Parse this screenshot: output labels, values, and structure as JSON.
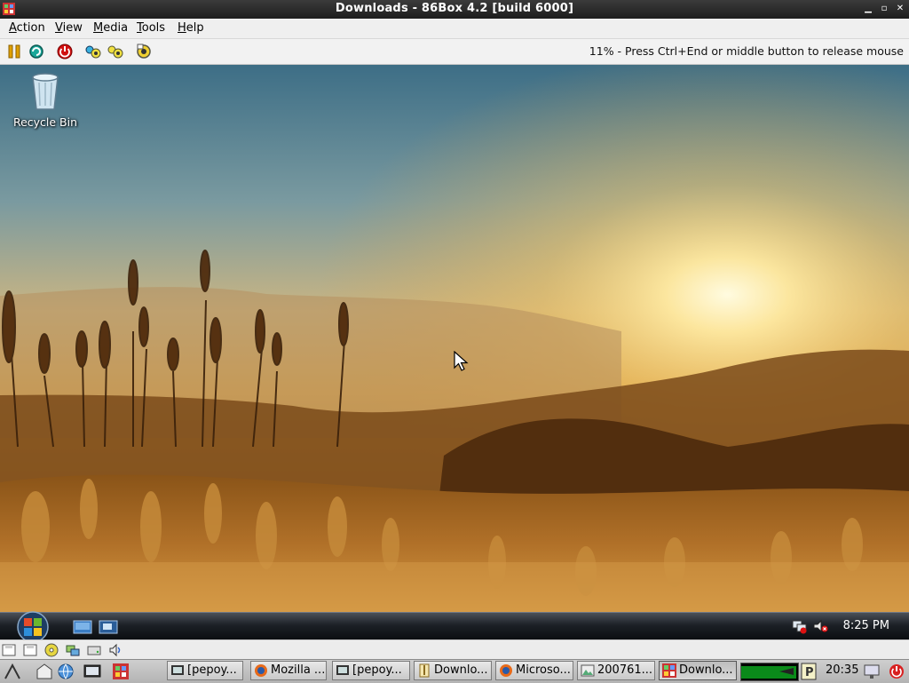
{
  "window": {
    "title": "Downloads - 86Box 4.2 [build 6000]",
    "app_icon": "86box-icon",
    "controls": [
      "minimize-icon",
      "maximize-icon",
      "close-icon"
    ]
  },
  "menubar": {
    "items": [
      "Action",
      "View",
      "Media",
      "Tools",
      "Help"
    ]
  },
  "toolbar": {
    "buttons": [
      "pause-icon",
      "reset-icon",
      "power-icon",
      "ctrl-alt-del-icon",
      "ctrl-alt-esc-icon",
      "settings-icon"
    ],
    "status": "11% - Press Ctrl+End or middle button to release mouse"
  },
  "desktop": {
    "icons": [
      {
        "label": "Recycle Bin",
        "icon": "recycle-bin-icon"
      }
    ]
  },
  "vista_taskbar": {
    "start": "windows-start-orb",
    "quick_launch": [
      "show-desktop-icon",
      "switch-windows-icon"
    ],
    "tray": [
      "network-disconnected-icon",
      "volume-muted-icon"
    ],
    "clock": "8:25 PM"
  },
  "host_status": {
    "icons": [
      "floppy-drive-icon",
      "floppy-drive-icon",
      "cdrom-icon",
      "network-icon",
      "hard-disk-icon",
      "sound-icon"
    ]
  },
  "host_panel": {
    "launchers": [
      "menu-icon",
      "home-folder-icon",
      "browser-icon",
      "terminal-icon",
      "86box-icon"
    ],
    "tasks": [
      {
        "label": "[pepoy...",
        "icon": "terminal-icon"
      },
      {
        "label": "Mozilla ...",
        "icon": "firefox-icon"
      },
      {
        "label": "[pepoy...",
        "icon": "terminal-icon"
      },
      {
        "label": "Downlo...",
        "icon": "archive-icon"
      },
      {
        "label": "Microso...",
        "icon": "firefox-icon"
      },
      {
        "label": "200761...",
        "icon": "image-viewer-icon"
      },
      {
        "label": "Downlo...",
        "icon": "86box-icon",
        "active": true
      }
    ],
    "tray": [
      "cpu-monitor-icon",
      "keyboard-layout-icon",
      "parking-icon"
    ],
    "clock": "20:35",
    "end_icons": [
      "display-icon",
      "power-icon"
    ]
  }
}
